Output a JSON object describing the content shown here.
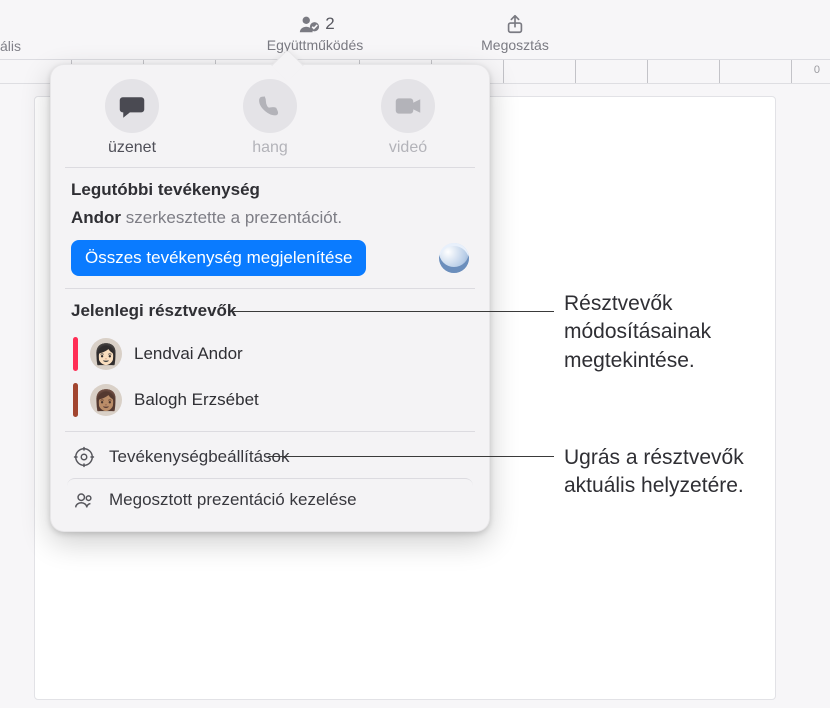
{
  "toolbar": {
    "left_truncated": "ális",
    "collab_count": "2",
    "collab_label": "Együttműködés",
    "share_label": "Megosztás"
  },
  "ruler": {
    "right_value": "0"
  },
  "popover": {
    "actions": {
      "message": "üzenet",
      "audio": "hang",
      "video": "videó"
    },
    "recent_heading": "Legutóbbi tevékenység",
    "recent_actor": "Andor",
    "recent_text": " szerkesztette a prezentációt.",
    "show_all_label": "Összes tevékenység megjelenítése",
    "participants_heading": "Jelenlegi résztvevők",
    "participants": [
      {
        "name": "Lendvai Andor",
        "color": "#ff2d55",
        "emoji": "👩🏻"
      },
      {
        "name": "Balogh Erzsébet",
        "color": "#a2452f",
        "emoji": "👩🏽"
      }
    ],
    "footer": {
      "activity_settings": "Tevékenységbeállítások",
      "manage_shared": "Megosztott prezentáció kezelése"
    }
  },
  "callouts": {
    "c1": "Résztvevők módosításainak megtekintése.",
    "c2": "Ugrás a résztvevők aktuális helyzetére."
  }
}
